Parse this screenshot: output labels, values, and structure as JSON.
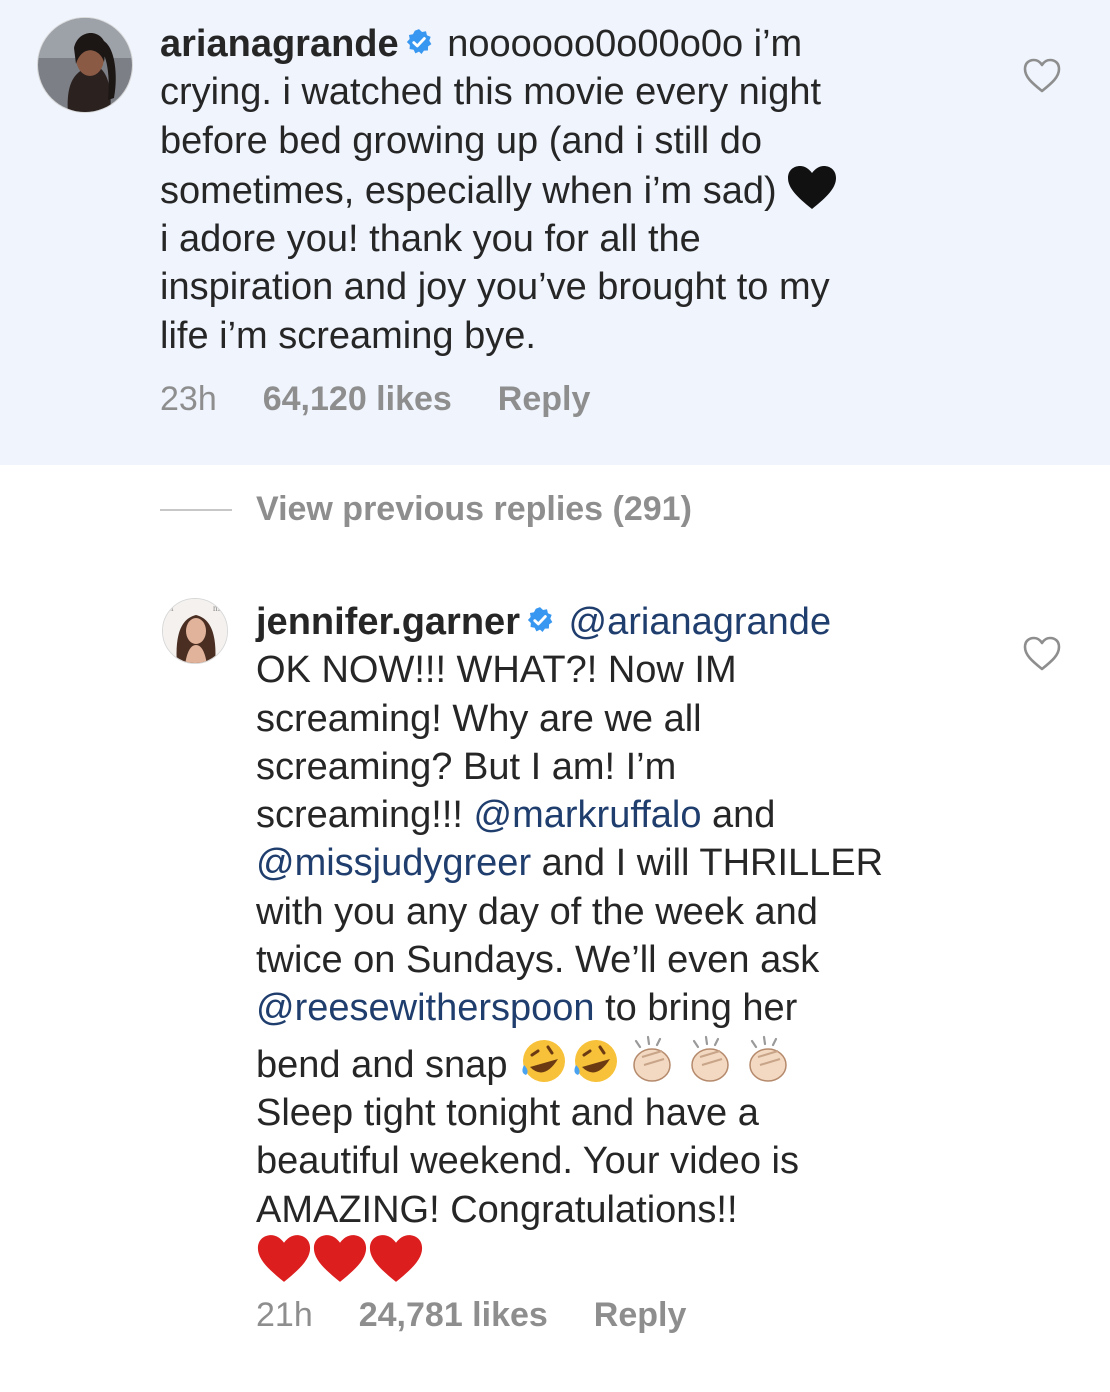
{
  "comments": [
    {
      "username": "arianagrande",
      "lines": [
        "noooooo0o00o0o i’m",
        "crying. i watched this movie every night",
        "before bed growing up (and i still do",
        "sometimes, especially when i’m sad)",
        "i adore you! thank you for all the",
        "inspiration and joy you’ve brought to my",
        "life i’m screaming bye."
      ],
      "time": "23h",
      "likes": "64,120 likes",
      "reply": "Reply"
    },
    {
      "username": "jennifer.garner",
      "mention_1": "@arianagrande",
      "l2": "OK NOW!!! WHAT?! Now IM",
      "l3": "screaming!  Why are we all",
      "l4": "screaming? But I am! I’m",
      "l5a": "screaming!!! ",
      "mention_2": "@markruffalo",
      "l5b": " and",
      "mention_3": "@missjudygreer",
      "l6b": " and I will THRILLER",
      "l7": "with you any day of the week and",
      "l8": "twice on Sundays.  We’ll even ask",
      "mention_4": "@reesewitherspoon",
      "l9b": " to bring her",
      "l10": "bend and snap ",
      "l11": "Sleep tight tonight and have a",
      "l12": "beautiful weekend.  Your video is",
      "l13": "AMAZING! Congratulations!!",
      "time": "21h",
      "likes": "24,781 likes",
      "reply": "Reply"
    }
  ],
  "view_previous": "View previous replies (291)",
  "icons": [
    "verified-badge-icon",
    "black-heart-emoji",
    "rofl-emoji",
    "clapping-hands-emoji",
    "red-heart-emoji",
    "like-heart-icon"
  ],
  "colors": {
    "highlight_bg": "#eff4fd",
    "mention": "#1f3e6e",
    "meta": "#8e8e8e",
    "verified": "#3897f0"
  }
}
